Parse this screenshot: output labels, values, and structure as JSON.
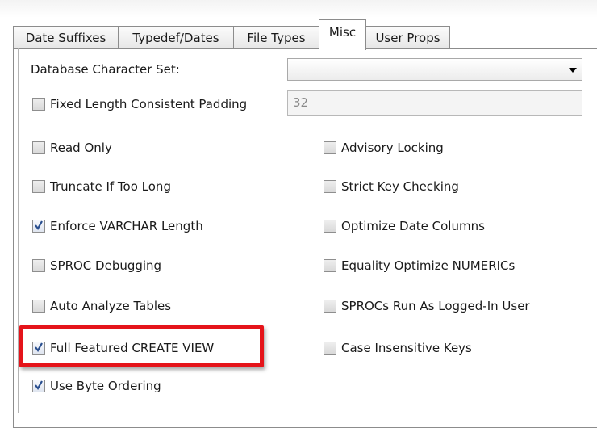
{
  "tabs": [
    {
      "label": "Date Suffixes",
      "active": false
    },
    {
      "label": "Typedef/Dates",
      "active": false
    },
    {
      "label": "File Types",
      "active": false
    },
    {
      "label": "Misc",
      "active": true
    },
    {
      "label": "User Props",
      "active": false
    }
  ],
  "charset": {
    "label": "Database Character Set:",
    "selected_value": ""
  },
  "padding": {
    "label": "Fixed Length Consistent Padding",
    "checked": false,
    "value": "32"
  },
  "left_options": [
    {
      "label": "Read Only",
      "checked": false
    },
    {
      "label": "Truncate If Too Long",
      "checked": false
    },
    {
      "label": "Enforce VARCHAR Length",
      "checked": true
    },
    {
      "label": "SPROC Debugging",
      "checked": false
    },
    {
      "label": "Auto Analyze Tables",
      "checked": false
    },
    {
      "label": "Full Featured CREATE VIEW",
      "checked": true
    },
    {
      "label": "Use Byte Ordering",
      "checked": true
    }
  ],
  "right_options": [
    {
      "label": "Advisory Locking",
      "checked": false
    },
    {
      "label": "Strict Key Checking",
      "checked": false
    },
    {
      "label": "Optimize Date Columns",
      "checked": false
    },
    {
      "label": "Equality Optimize NUMERICs",
      "checked": false
    },
    {
      "label": "SPROCs Run As Logged-In User",
      "checked": false
    },
    {
      "label": "Case Insensitive Keys",
      "checked": false
    }
  ],
  "colors": {
    "highlight_border": "#e5141a",
    "check_mark": "#2a4f8f"
  }
}
